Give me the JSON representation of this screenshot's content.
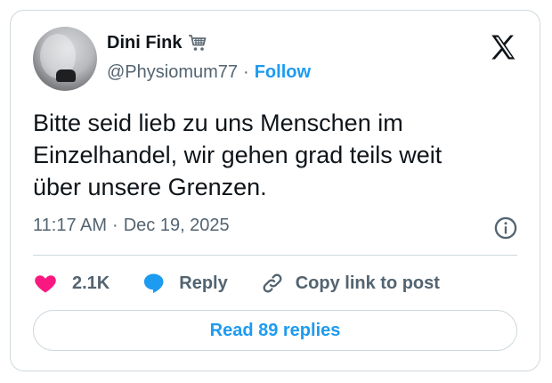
{
  "author": {
    "name": "Dini Fink",
    "emoji_icon": "shopping-cart-icon",
    "handle": "@Physiomum77",
    "separator": "·",
    "follow_label": "Follow"
  },
  "tweet": {
    "text": "Bitte seid lieb zu uns Menschen im\nEinzelhandel, wir gehen grad teils weit\nüber unsere Grenzen.",
    "time": "11:17 AM",
    "date_separator": "·",
    "date": "Dec 19, 2025"
  },
  "actions": {
    "like_count": "2.1K",
    "reply_label": "Reply",
    "copy_label": "Copy link to post"
  },
  "read_replies_label": "Read 89 replies",
  "colors": {
    "accent": "#1d9bf0",
    "like": "#f91880",
    "text": "#0f1419",
    "muted": "#536471",
    "border": "#cfd9de"
  }
}
